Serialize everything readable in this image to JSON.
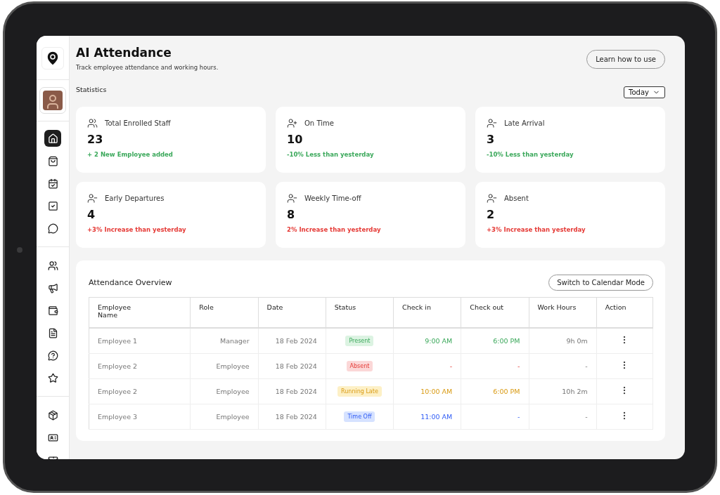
{
  "sidebar": {
    "items": [
      {
        "selected": true
      },
      {
        "selected": false
      },
      {
        "selected": false
      },
      {
        "selected": false
      },
      {
        "selected": false
      },
      {
        "selected": false
      },
      {
        "selected": false
      },
      {
        "selected": false
      },
      {
        "selected": false
      },
      {
        "selected": false
      },
      {
        "selected": false
      },
      {
        "selected": false
      },
      {
        "selected": false
      },
      {
        "selected": false
      }
    ]
  },
  "header": {
    "title": "AI Attendance",
    "subtitle": "Track employee attendance and working hours.",
    "help_button": "Learn how to use"
  },
  "statistics": {
    "title": "Statistics",
    "period": "Today",
    "cards": [
      {
        "label": "Total Enrolled Staff",
        "value": "23",
        "note": "+ 2 New Employee added",
        "color": "#3aa85a"
      },
      {
        "label": "On Time",
        "value": "10",
        "note": "-10% Less than yesterday",
        "color": "#3aa85a"
      },
      {
        "label": "Late Arrival",
        "value": "3",
        "note": "-10% Less than yesterday",
        "color": "#3aa85a"
      },
      {
        "label": "Early Departures",
        "value": "4",
        "note": "+3% Increase than yesterday",
        "color": "#e53935"
      },
      {
        "label": "Weekly Time-off",
        "value": "8",
        "note": "2% Increase than yesterday",
        "color": "#e53935"
      },
      {
        "label": "Absent",
        "value": "2",
        "note": "+3% Increase than yesterday",
        "color": "#e53935"
      }
    ]
  },
  "overview": {
    "title": "Attendance Overview",
    "switch_button": "Switch to Calendar Mode",
    "columns": [
      "Employee Name",
      "Role",
      "Date",
      "Status",
      "Check in",
      "Check out",
      "Work Hours",
      "Action"
    ],
    "rows": [
      {
        "name": "Employee 1",
        "role": "Manager",
        "date": "18 Feb 2024",
        "status": "Present",
        "kind": "present",
        "check_in": "9:00 AM",
        "check_out": "6:00 PM",
        "hours": "9h 0m"
      },
      {
        "name": "Employee 2",
        "role": "Employee",
        "date": "18 Feb 2024",
        "status": "Absent",
        "kind": "absent",
        "check_in": "-",
        "check_out": "-",
        "hours": "-"
      },
      {
        "name": "Employee 2",
        "role": "Employee",
        "date": "18 Feb 2024",
        "status": "Running Late",
        "kind": "late",
        "check_in": "10:00 AM",
        "check_out": "6:00 PM",
        "hours": "10h 2m"
      },
      {
        "name": "Employee 3",
        "role": "Employee",
        "date": "18 Feb 2024",
        "status": "Time Off",
        "kind": "off",
        "check_in": "11:00 AM",
        "check_out": "-",
        "hours": "-"
      }
    ]
  }
}
